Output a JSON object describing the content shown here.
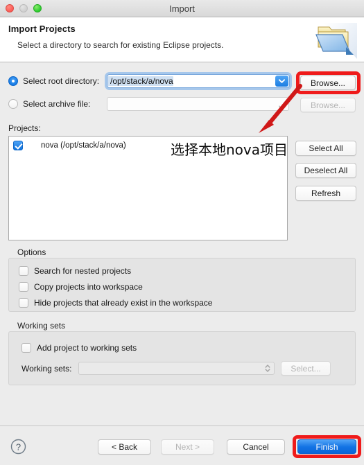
{
  "window": {
    "title": "Import",
    "traffic_lights": [
      "close-red",
      "minimize-grey",
      "zoom-green"
    ]
  },
  "header": {
    "title": "Import Projects",
    "subtitle": "Select a directory to search for existing Eclipse projects.",
    "icon": "import-folder-icon"
  },
  "source": {
    "root_directory": {
      "label": "Select root directory:",
      "value": "/opt/stack/a/nova",
      "selected": true,
      "browse_label": "Browse..."
    },
    "archive_file": {
      "label": "Select archive file:",
      "value": "",
      "selected": false,
      "browse_label": "Browse..."
    }
  },
  "projects": {
    "label": "Projects:",
    "items": [
      {
        "label": "nova (/opt/stack/a/nova)",
        "checked": true
      }
    ],
    "buttons": {
      "select_all": "Select All",
      "deselect_all": "Deselect All",
      "refresh": "Refresh"
    }
  },
  "options": {
    "label": "Options",
    "items": [
      {
        "label": "Search for nested projects",
        "checked": false
      },
      {
        "label": "Copy projects into workspace",
        "checked": false
      },
      {
        "label": "Hide projects that already exist in the workspace",
        "checked": false
      }
    ]
  },
  "working_sets": {
    "label": "Working sets",
    "add_checkbox": {
      "label": "Add project to working sets",
      "checked": false
    },
    "field_label": "Working sets:",
    "field_value": "",
    "select_label": "Select..."
  },
  "footer": {
    "help": "?",
    "back": "< Back",
    "next": "Next >",
    "cancel": "Cancel",
    "finish": "Finish"
  },
  "annotations": {
    "note_cn": "选择本地nova项目",
    "highlight_color": "#ef1b1b",
    "arrow_color": "#d01818",
    "targets": [
      "browse-button",
      "finish-button"
    ]
  }
}
